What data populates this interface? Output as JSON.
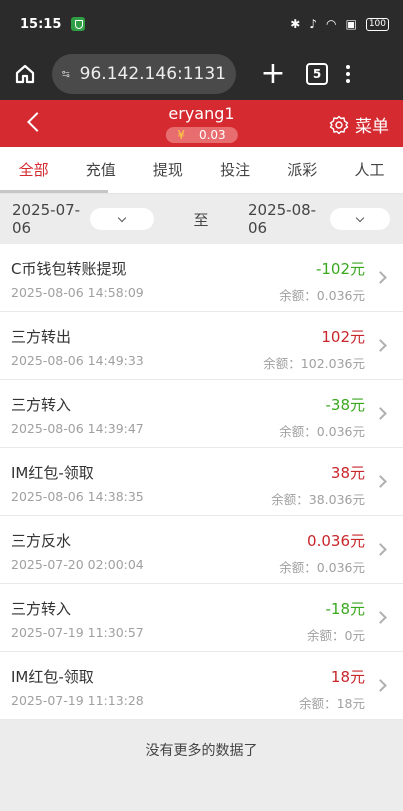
{
  "status_bar": {
    "time": "15:15",
    "battery": "100"
  },
  "browser": {
    "url": "96.142.146:1131",
    "tab_count": "5",
    "new_tab": "+"
  },
  "header": {
    "username": "eryang1",
    "currency_symbol": "¥",
    "balance": "0.03",
    "menu_label": "菜单"
  },
  "tabs": [
    {
      "label": "全部",
      "active": true
    },
    {
      "label": "充值",
      "active": false
    },
    {
      "label": "提现",
      "active": false
    },
    {
      "label": "投注",
      "active": false
    },
    {
      "label": "派彩",
      "active": false
    },
    {
      "label": "人工",
      "active": false
    }
  ],
  "date_filter": {
    "start": "2025-07-06",
    "separator": "至",
    "end": "2025-08-06"
  },
  "transactions": [
    {
      "title": "C币钱包转账提现",
      "time": "2025-08-06 14:58:09",
      "amount": "-102元",
      "remaining": "余额：0.036元",
      "type": "neg"
    },
    {
      "title": "三方转出",
      "time": "2025-08-06 14:49:33",
      "amount": "102元",
      "remaining": "余额：102.036元",
      "type": "pos"
    },
    {
      "title": "三方转入",
      "time": "2025-08-06 14:39:47",
      "amount": "-38元",
      "remaining": "余额：0.036元",
      "type": "neg"
    },
    {
      "title": "IM红包-领取",
      "time": "2025-08-06 14:38:35",
      "amount": "38元",
      "remaining": "余额：38.036元",
      "type": "pos"
    },
    {
      "title": "三方反水",
      "time": "2025-07-20 02:00:04",
      "amount": "0.036元",
      "remaining": "余额：0.036元",
      "type": "pos"
    },
    {
      "title": "三方转入",
      "time": "2025-07-19 11:30:57",
      "amount": "-18元",
      "remaining": "余额：0元",
      "type": "neg"
    },
    {
      "title": "IM红包-领取",
      "time": "2025-07-19 11:13:28",
      "amount": "18元",
      "remaining": "余额：18元",
      "type": "pos"
    }
  ],
  "footer": {
    "no_more": "没有更多的数据了"
  },
  "colors": {
    "brand_red": "#d42a30",
    "negative_green": "#3aa81f",
    "positive_red": "#c8262b"
  }
}
